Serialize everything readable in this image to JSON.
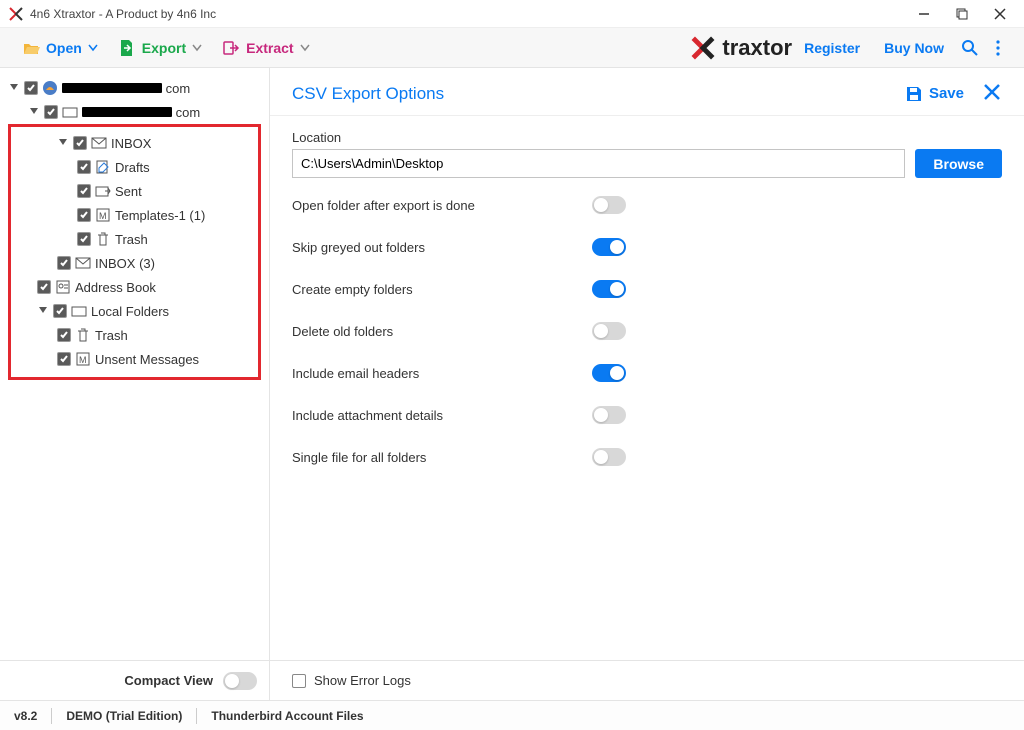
{
  "window": {
    "title": "4n6 Xtraxtor - A Product by 4n6 Inc"
  },
  "toolbar": {
    "open": "Open",
    "export": "Export",
    "extract": "Extract",
    "register": "Register",
    "buynow": "Buy Now",
    "brand_suffix": "traxtor"
  },
  "tree": {
    "account_suffix": "com",
    "sub_suffix": "com",
    "inbox": "INBOX",
    "drafts": "Drafts",
    "sent": "Sent",
    "templates": "Templates-1  (1)",
    "trash": "Trash",
    "inbox2": "INBOX  (3)",
    "addressbook": "Address Book",
    "localfolders": "Local Folders",
    "ltrash": "Trash",
    "unsent": "Unsent Messages"
  },
  "compact": {
    "label": "Compact View"
  },
  "panel": {
    "title": "CSV Export Options",
    "save": "Save",
    "location_label": "Location",
    "location_value": "C:\\Users\\Admin\\Desktop",
    "browse": "Browse",
    "opts": {
      "openfolder": "Open folder after export is done",
      "skipgrey": "Skip greyed out folders",
      "createempty": "Create empty folders",
      "deleteold": "Delete old folders",
      "includeheaders": "Include email headers",
      "includeattach": "Include attachment details",
      "singlefile": "Single file for all folders"
    },
    "errorlogs": "Show Error Logs"
  },
  "status": {
    "version": "v8.2",
    "edition": "DEMO (Trial Edition)",
    "source": "Thunderbird Account Files"
  }
}
